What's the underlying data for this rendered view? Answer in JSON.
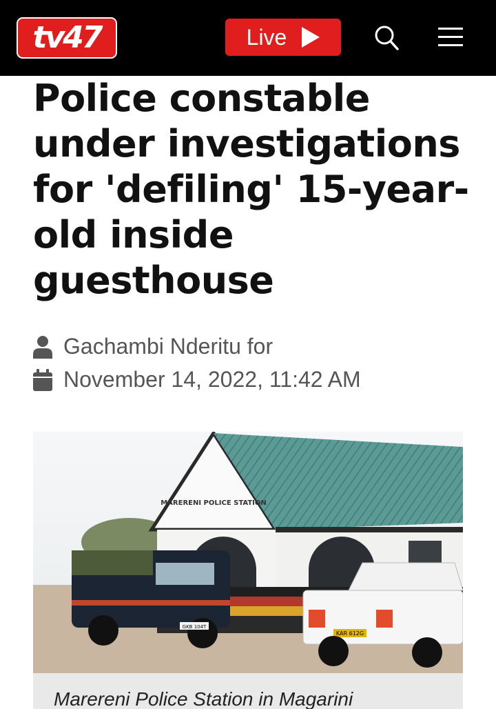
{
  "header": {
    "logo_text": "tv47",
    "live_label": "Live",
    "icons": [
      "play-icon",
      "search-icon",
      "hamburger-menu-icon"
    ],
    "brand_color": "#e01e1e"
  },
  "article": {
    "headline": "Police constable under investigations for 'defiling' 15-year-old inside guesthouse",
    "author": "Gachambi Nderitu for",
    "date": "November 14, 2022, 11:42 AM",
    "image": {
      "sign_text": "MARERENI POLICE STATION",
      "plate_left": "GKB 104T",
      "plate_right": "KAR 612G",
      "caption": "Marereni Police Station in Magarini"
    }
  }
}
